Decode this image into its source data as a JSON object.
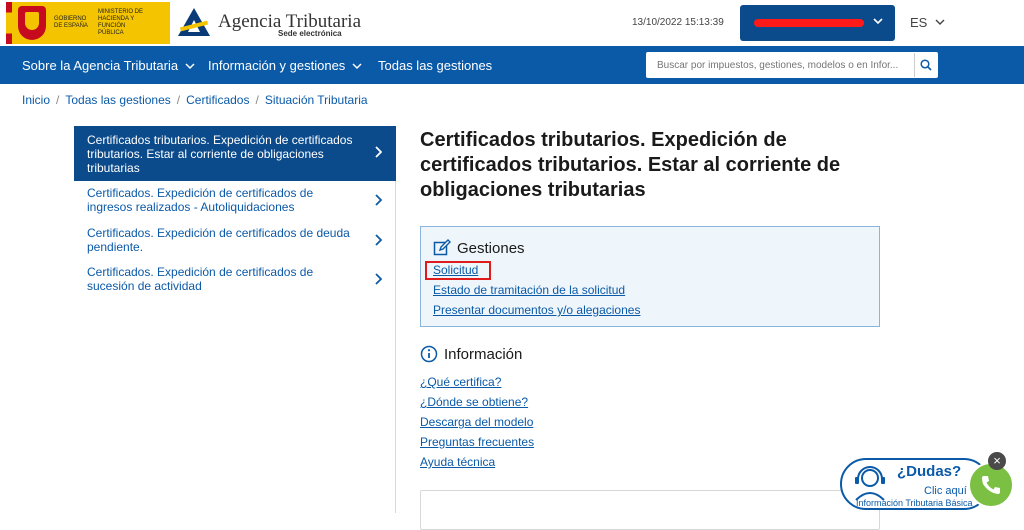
{
  "header": {
    "gov_line1": "GOBIERNO DE ESPAÑA",
    "gov_line2": "MINISTERIO DE HACIENDA Y FUNCIÓN PÚBLICA",
    "agency_name": "Agencia Tributaria",
    "agency_sub": "Sede electrónica",
    "datetime": "13/10/2022 15:13:39",
    "language": "ES"
  },
  "nav": {
    "items": [
      "Sobre la Agencia Tributaria",
      "Información y gestiones",
      "Todas las gestiones"
    ],
    "search_placeholder": "Buscar por impuestos, gestiones, modelos o en Infor..."
  },
  "breadcrumb": [
    "Inicio",
    "Todas las gestiones",
    "Certificados",
    "Situación Tributaria"
  ],
  "sidebar": {
    "items": [
      "Certificados tributarios. Expedición de certificados tributarios. Estar al corriente de obligaciones tributarias",
      "Certificados. Expedición de certificados de ingresos realizados - Autoliquidaciones",
      "Certificados. Expedición de certificados de deuda pendiente.",
      "Certificados. Expedición de certificados de sucesión de actividad"
    ]
  },
  "main": {
    "title": "Certificados tributarios. Expedición de certificados tributarios. Estar al corriente de obligaciones tributarias",
    "gestiones": {
      "heading": "Gestiones",
      "links": [
        "Solicitud",
        "Estado de tramitación de la solicitud",
        "Presentar documentos y/o alegaciones"
      ]
    },
    "informacion": {
      "heading": "Información",
      "links": [
        "¿Qué certifica?",
        "¿Dónde se obtiene?",
        "Descarga del modelo",
        "Preguntas frecuentes",
        "Ayuda técnica"
      ]
    }
  },
  "help": {
    "title": "¿Dudas?",
    "link": "Clic aquí",
    "subtitle": "Información Tributaria Básica"
  },
  "colors": {
    "brand_blue": "#0b5aa8",
    "active_blue": "#0b4a8b",
    "highlight_red": "#e01b1b",
    "phone_green": "#7bc043"
  }
}
